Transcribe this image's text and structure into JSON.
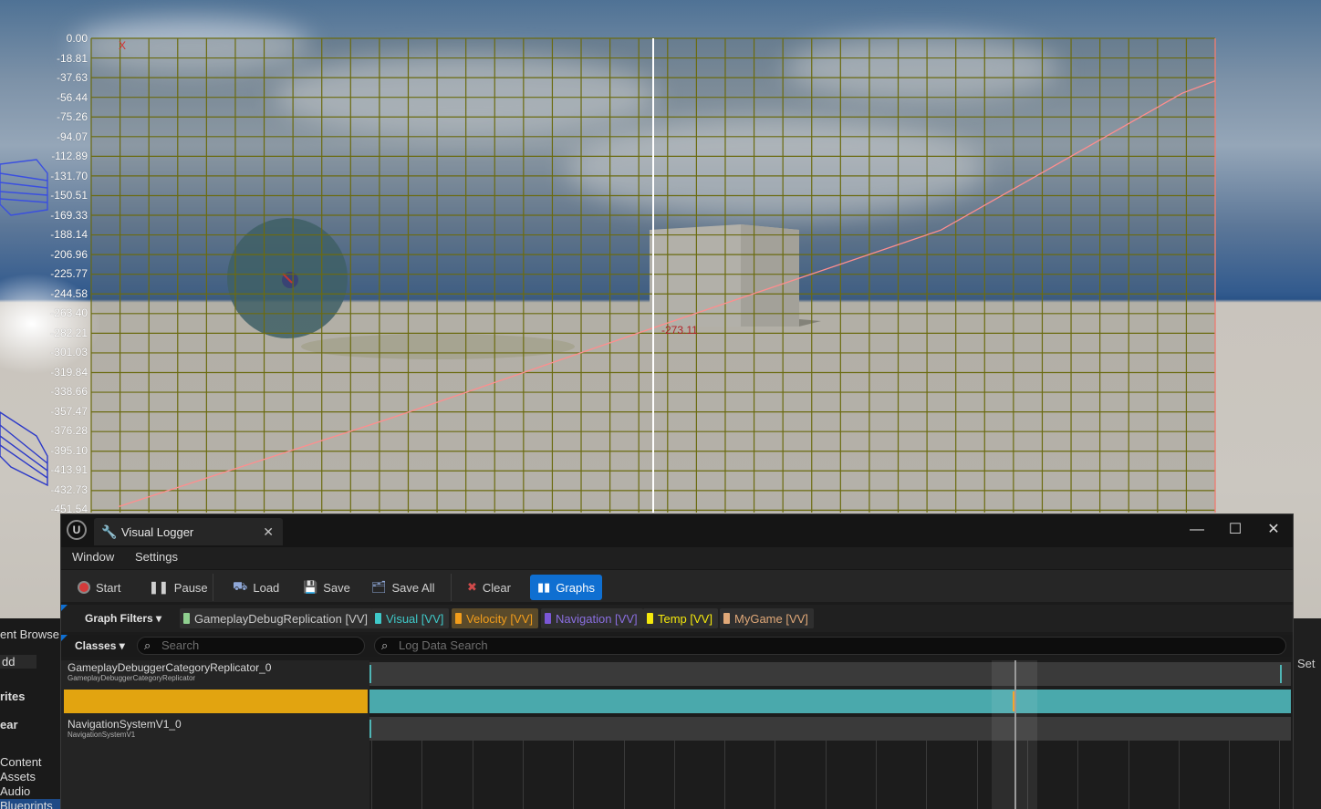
{
  "graph": {
    "x_label": "X",
    "y_ticks": [
      "0.00",
      "-18.81",
      "-37.63",
      "-56.44",
      "-75.26",
      "-94.07",
      "-112.89",
      "-131.70",
      "-150.51",
      "-169.33",
      "-188.14",
      "-206.96",
      "-225.77",
      "-244.58",
      "-263.40",
      "-282.21",
      "-301.03",
      "-319.84",
      "-338.66",
      "-357.47",
      "-376.28",
      "-395.10",
      "-413.91",
      "-432.73",
      "-451.54",
      "-4",
      "-4",
      "-5",
      "-5"
    ],
    "cursor_value": "-273.11",
    "colors": {
      "grid": "#6b6b10",
      "line": "#ff8e8e",
      "cursor": "#ffffff"
    }
  },
  "chart_data": {
    "type": "line",
    "title": "",
    "xlabel": "X",
    "ylabel": "",
    "ylim": [
      -451.54,
      0
    ],
    "series": [
      {
        "x": [
          0.0,
          0.25,
          0.5,
          0.75,
          0.97,
          1.0
        ],
        "y": [
          -452,
          -366,
          -275,
          -185,
          -53,
          -41
        ]
      }
    ],
    "cursor": {
      "x": 0.5,
      "value": -273.11
    },
    "grid": true
  },
  "editor_left": {
    "rows": [
      "ent Browse",
      "dd",
      "rites",
      "ear",
      "Content",
      "Assets",
      "Audio",
      "Blueprints"
    ]
  },
  "editor_right": {
    "label": "Set"
  },
  "window": {
    "tab_title": "Visual Logger",
    "logo": "U",
    "menu": [
      "Window",
      "Settings"
    ]
  },
  "toolbar": [
    {
      "label": "Start",
      "icon": "record-icon"
    },
    {
      "label": "Pause",
      "icon": "pause-icon"
    },
    {
      "label": "Load",
      "icon": "load-icon"
    },
    {
      "label": "Save",
      "icon": "save-icon"
    },
    {
      "label": "Save All",
      "icon": "save-all-icon"
    },
    {
      "label": "Clear",
      "icon": "clear-icon"
    },
    {
      "label": "Graphs",
      "icon": "graphs-icon",
      "active": true
    }
  ],
  "filters": {
    "button": "Graph Filters",
    "chips": [
      {
        "label": "GameplayDebugReplication [VV]",
        "color": "#8fcf8f",
        "text": "#c8c8c8"
      },
      {
        "label": "Visual [VV]",
        "color": "#3fc9c9",
        "text": "#3fc9c9"
      },
      {
        "label": "Velocity [VV]",
        "color": "#f29d1b",
        "text": "#f29d1b"
      },
      {
        "label": "Navigation [VV]",
        "color": "#7b57d6",
        "text": "#8a6ee0"
      },
      {
        "label": "Temp [VV]",
        "color": "#f4e80c",
        "text": "#f4e80c"
      },
      {
        "label": "MyGame [VV]",
        "color": "#e0a878",
        "text": "#e0a878"
      }
    ]
  },
  "search": {
    "classes_button": "Classes",
    "class_placeholder": "Search",
    "log_placeholder": "Log Data Search"
  },
  "classes": [
    {
      "name": "GameplayDebuggerCategoryReplicator_0",
      "sub": "GameplayDebuggerCategoryReplicator",
      "selected": false
    },
    {
      "name": "",
      "sub": "",
      "selected": true
    },
    {
      "name": "NavigationSystemV1_0",
      "sub": "NavigationSystemV1",
      "selected": false
    }
  ]
}
